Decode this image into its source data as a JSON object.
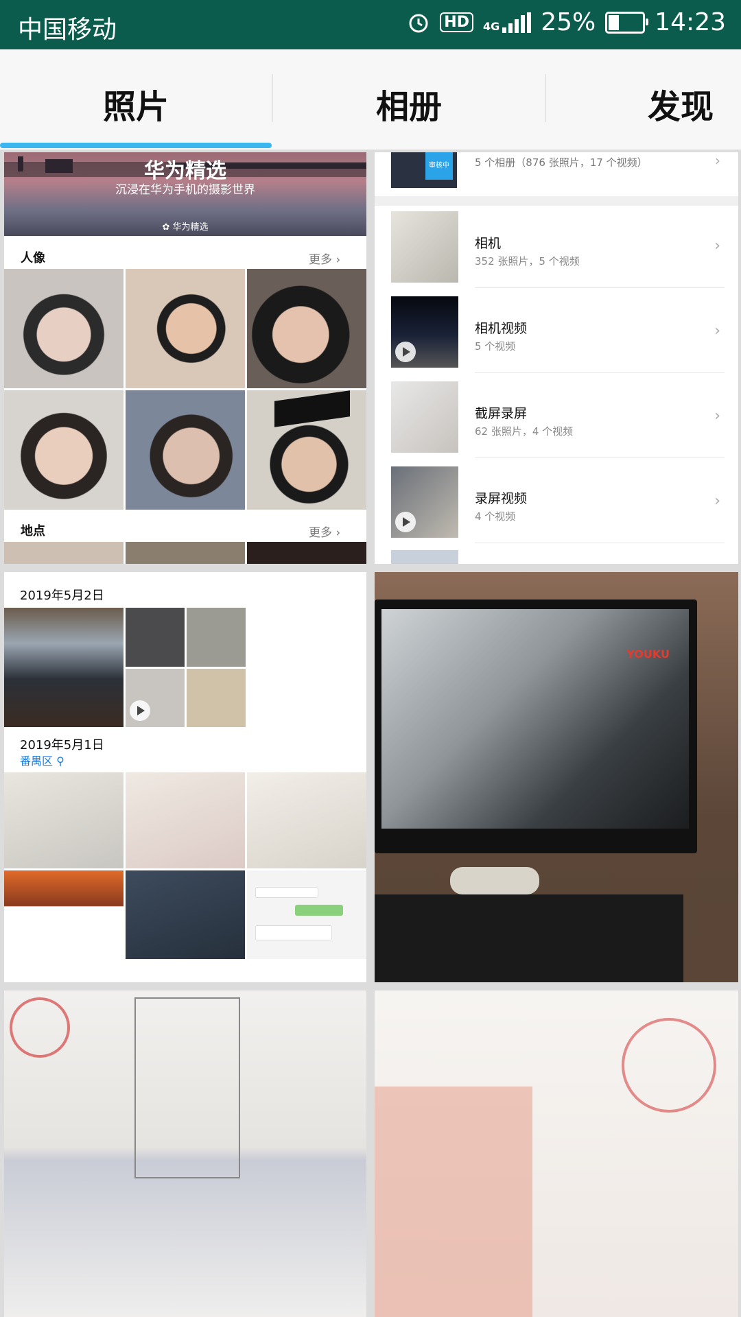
{
  "status_bar": {
    "carrier": "中国移动",
    "hd": "HD",
    "network": "4G",
    "battery_pct": "25%",
    "time": "14:23"
  },
  "tabs": [
    "照片",
    "相册",
    "发现"
  ],
  "discover": {
    "banner_title": "华为精选",
    "banner_subtitle": "沉浸在华为手机的摄影世界",
    "banner_brand": "华为精选",
    "people_title": "人像",
    "people_more": "更多",
    "places_title": "地点",
    "places_more": "更多"
  },
  "albums": {
    "summary": "5 个相册（876 张照片，17 个视频）",
    "items": [
      {
        "name": "相机",
        "count": "352 张照片，5 个视频"
      },
      {
        "name": "相机视频",
        "count": "5 个视频"
      },
      {
        "name": "截屏录屏",
        "count": "62 张照片，4 个视频"
      },
      {
        "name": "录屏视频",
        "count": "4 个视频"
      }
    ]
  },
  "timeline": {
    "date1": "2019年5月2日",
    "date2": "2019年5月1日",
    "location": "番禺区"
  },
  "photo_text": {
    "youku": "YOUKU"
  }
}
